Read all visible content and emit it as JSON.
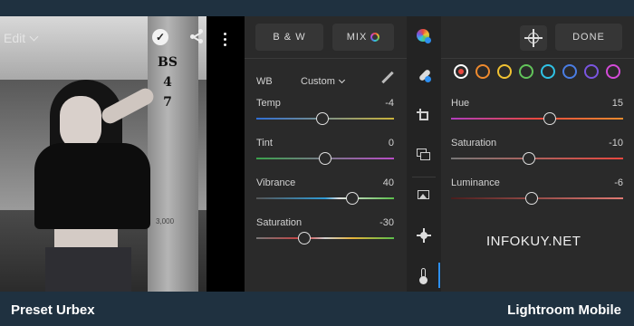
{
  "photo": {
    "edit_label": "Edit",
    "sign_lines": [
      "BS",
      "4",
      "7"
    ],
    "pole_number": "3,000"
  },
  "left_panel": {
    "bw_label": "B & W",
    "mix_label": "MIX",
    "wb_label": "WB",
    "wb_mode": "Custom",
    "sliders": [
      {
        "label": "Temp",
        "value": "-4",
        "level": -4,
        "min": -100,
        "max": 100
      },
      {
        "label": "Tint",
        "value": "0",
        "level": 0,
        "min": -100,
        "max": 100
      },
      {
        "label": "Vibrance",
        "value": "40",
        "level": 40,
        "min": -100,
        "max": 100
      },
      {
        "label": "Saturation",
        "value": "-30",
        "level": -30,
        "min": -100,
        "max": 100
      }
    ]
  },
  "tools": {
    "icons": [
      "color-mix-icon",
      "healing-icon",
      "crop-icon",
      "layers-icon",
      "image-adjust-icon",
      "light-icon",
      "temperature-icon"
    ]
  },
  "right_panel": {
    "done_label": "DONE",
    "swatches": [
      {
        "name": "red",
        "color": "#e8483f"
      },
      {
        "name": "orange",
        "color": "#ef8a2e"
      },
      {
        "name": "yellow",
        "color": "#f1c232"
      },
      {
        "name": "green",
        "color": "#62c45a"
      },
      {
        "name": "aqua",
        "color": "#2fc2e5"
      },
      {
        "name": "blue",
        "color": "#4a7de3"
      },
      {
        "name": "purple",
        "color": "#7a55e0"
      },
      {
        "name": "magenta",
        "color": "#d44bd8"
      }
    ],
    "sliders": [
      {
        "label": "Hue",
        "value": "15",
        "level": 15,
        "min": -100,
        "max": 100
      },
      {
        "label": "Saturation",
        "value": "-10",
        "level": -10,
        "min": -100,
        "max": 100
      },
      {
        "label": "Luminance",
        "value": "-6",
        "level": -6,
        "min": -100,
        "max": 100
      }
    ]
  },
  "watermark": "INFOKUY.NET",
  "footer": {
    "left": "Preset Urbex",
    "right": "Lightroom Mobile"
  },
  "colors": {
    "accent": "#2d8ff0",
    "panel": "#2a2a2a",
    "background": "#1f3140"
  }
}
